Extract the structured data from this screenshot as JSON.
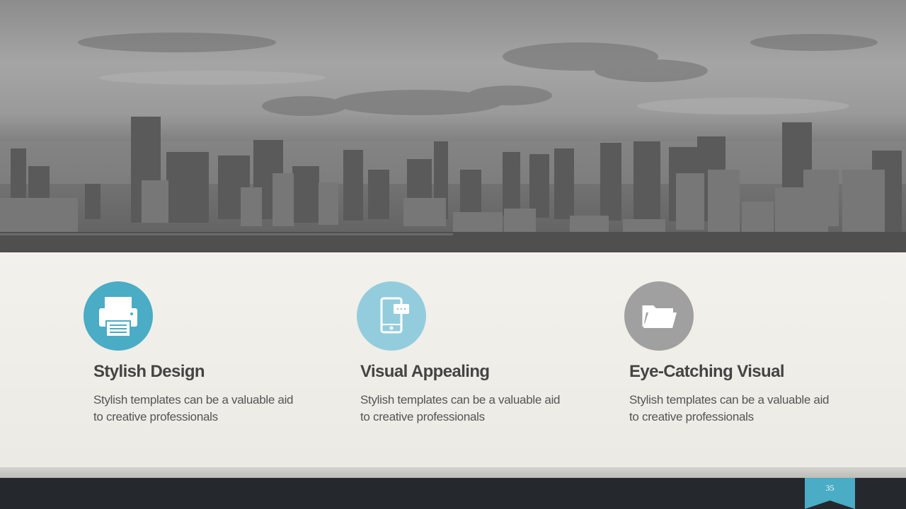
{
  "hero": {
    "image": "grayscale-city-skyline-photo"
  },
  "features": [
    {
      "icon": "printer-icon",
      "color": "#4aacc5",
      "title": "Stylish Design",
      "description": "Stylish templates can be a valuable aid to creative professionals"
    },
    {
      "icon": "mobile-phone-icon",
      "color": "#93cddd",
      "title": "Visual Appealing",
      "description": "Stylish templates can be a valuable aid to creative professionals"
    },
    {
      "icon": "folder-icon",
      "color": "#a0a0a0",
      "title": "Eye-Catching Visual",
      "description": "Stylish templates can be a valuable aid to creative professionals"
    }
  ],
  "footer": {
    "page_number": "35",
    "accent_color": "#4aacc5"
  }
}
